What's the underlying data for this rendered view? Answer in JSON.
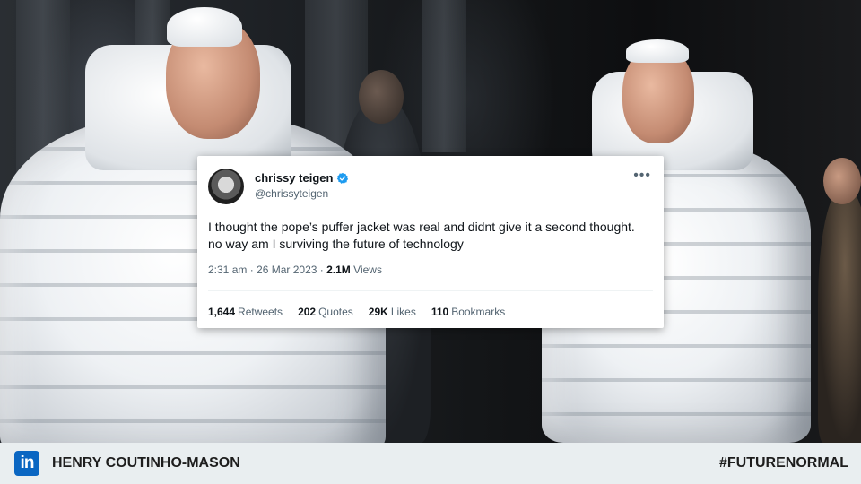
{
  "tweet": {
    "display_name": "chrissy teigen",
    "handle": "@chrissyteigen",
    "verified": true,
    "more_icon": "more-horizontal-icon",
    "text": "I thought the pope’s puffer jacket was real and didnt give it a second thought. no way am I surviving the future of technology",
    "time": "2:31 am",
    "date": "26 Mar 2023",
    "views_count": "2.1M",
    "views_label": "Views",
    "stats": [
      {
        "count": "1,644",
        "label": "Retweets"
      },
      {
        "count": "202",
        "label": "Quotes"
      },
      {
        "count": "29K",
        "label": "Likes"
      },
      {
        "count": "110",
        "label": "Bookmarks"
      }
    ]
  },
  "footer": {
    "logo_icon": "linkedin-icon",
    "logo_text": "in",
    "author": "HENRY COUTINHO-MASON",
    "hashtag": "#FUTURENORMAL"
  },
  "colors": {
    "verified_blue": "#1d9bf0",
    "linkedin_blue": "#0a66c2",
    "footer_bg": "#e9eef0"
  }
}
